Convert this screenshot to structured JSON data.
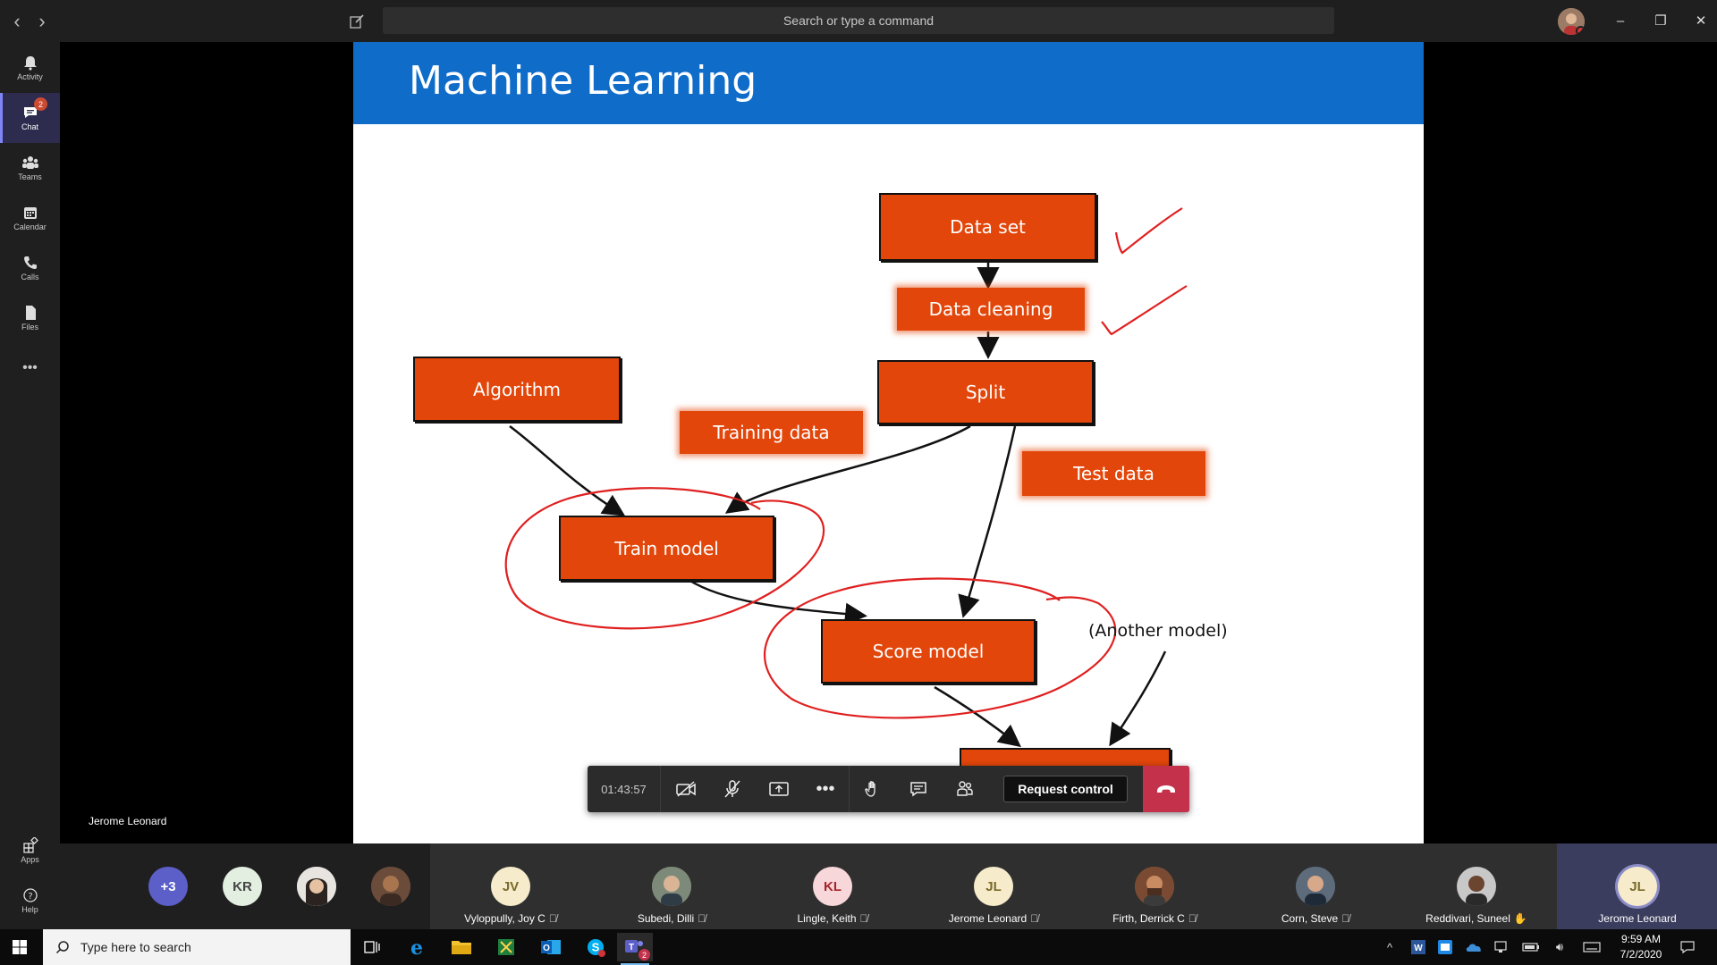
{
  "titlebar": {
    "search_placeholder": "Search or type a command",
    "back_icon": "chevron-left-icon",
    "forward_icon": "chevron-right-icon",
    "compose_icon": "compose-icon",
    "minimize": "–",
    "restore": "❐",
    "close": "✕"
  },
  "rail": {
    "items": [
      {
        "label": "Activity",
        "icon": "bell-icon"
      },
      {
        "label": "Chat",
        "icon": "chat-icon",
        "badge": "2"
      },
      {
        "label": "Teams",
        "icon": "teams-icon"
      },
      {
        "label": "Calendar",
        "icon": "calendar-icon"
      },
      {
        "label": "Calls",
        "icon": "phone-icon"
      },
      {
        "label": "Files",
        "icon": "file-icon"
      }
    ],
    "more": "•••",
    "bottom": [
      {
        "label": "Apps",
        "icon": "apps-icon"
      },
      {
        "label": "Help",
        "icon": "help-icon"
      }
    ]
  },
  "stage": {
    "presenter_name": "Jerome Leonard"
  },
  "slide": {
    "title": "Machine Learning",
    "boxes": {
      "data_set": "Data set",
      "data_cleaning": "Data cleaning",
      "algorithm": "Algorithm",
      "split": "Split",
      "training_data": "Training data",
      "test_data": "Test data",
      "train_model": "Train model",
      "score_model": "Score model"
    },
    "note": "(Another model)",
    "colors": {
      "header": "#0f6cc9",
      "box": "#e2460a",
      "ink": "#e02020"
    }
  },
  "controls": {
    "timer": "01:43:57",
    "request_control": "Request control",
    "icons": [
      "camera-off-icon",
      "mic-off-icon",
      "share-screen-icon",
      "more-icon",
      "raise-hand-icon",
      "chat-icon",
      "participants-icon",
      "hang-up-icon"
    ]
  },
  "strip": {
    "overflow": "+3",
    "mini": [
      {
        "initials": "KR"
      },
      {
        "initials": ""
      },
      {
        "initials": ""
      }
    ],
    "tiles": [
      {
        "initials": "JV",
        "name": "Vyloppully, Joy C"
      },
      {
        "initials": "",
        "name": "Subedi, Dilli"
      },
      {
        "initials": "KL",
        "name": "Lingle, Keith"
      },
      {
        "initials": "JL",
        "name": "Jerome Leonard"
      },
      {
        "initials": "",
        "name": "Firth, Derrick C"
      },
      {
        "initials": "",
        "name": "Corn, Steve"
      },
      {
        "initials": "",
        "name": "Reddivari, Suneel"
      },
      {
        "initials": "JL",
        "name": "Jerome Leonard"
      }
    ]
  },
  "taskbar": {
    "search_placeholder": "Type here to search",
    "time": "9:59 AM",
    "date": "7/2/2020",
    "teams_badge": "2"
  }
}
